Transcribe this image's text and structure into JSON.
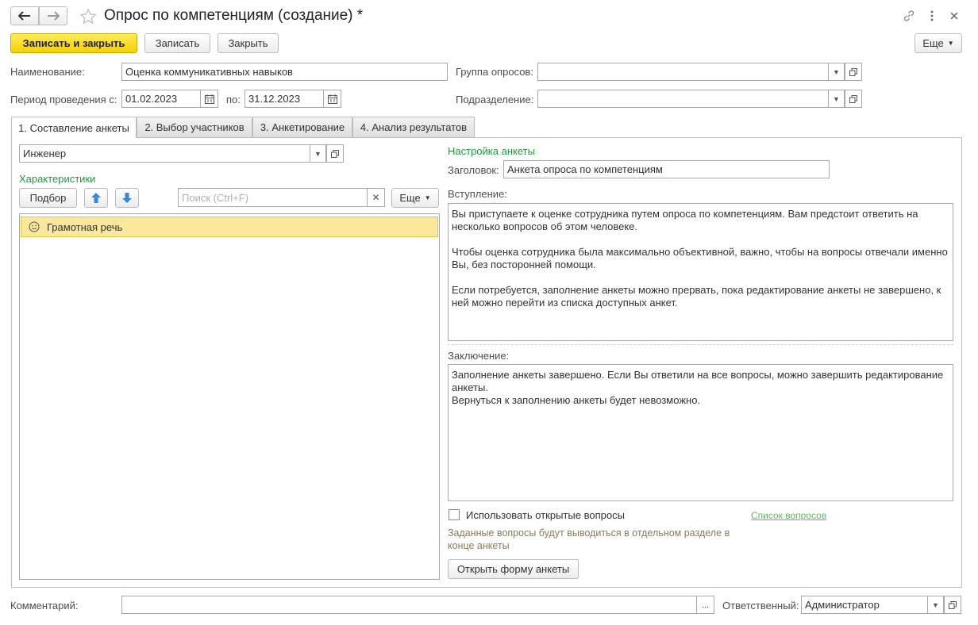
{
  "window": {
    "title": "Опрос по компетенциям (создание) *"
  },
  "toolbar": {
    "save_close_label": "Записать и закрыть",
    "save_label": "Записать",
    "close_label": "Закрыть",
    "more_label": "Еще"
  },
  "header": {
    "name_label": "Наименование:",
    "name_value": "Оценка коммуникативных навыков",
    "group_label": "Группа опросов:",
    "group_value": "",
    "period_label": "Период проведения с:",
    "period_from": "01.02.2023",
    "period_to_label": "по:",
    "period_to": "31.12.2023",
    "department_label": "Подразделение:",
    "department_value": ""
  },
  "tabs": [
    {
      "label": "1. Составление анкеты",
      "active": true
    },
    {
      "label": "2. Выбор участников",
      "active": false
    },
    {
      "label": "3. Анкетирование",
      "active": false
    },
    {
      "label": "4. Анализ результатов",
      "active": false
    }
  ],
  "left_panel": {
    "position_value": "Инженер",
    "characteristics_title": "Характеристики",
    "pick_label": "Подбор",
    "search_placeholder": "Поиск (Ctrl+F)",
    "more_label": "Еще",
    "list_items": [
      {
        "label": "Грамотная речь",
        "selected": true
      }
    ]
  },
  "right_panel": {
    "section_title": "Настройка анкеты",
    "heading_label": "Заголовок:",
    "heading_value": "Анкета опроса по компетенциям",
    "intro_label": "Вступление:",
    "intro_text": "Вы приступаете к оценке сотрудника путем опроса по компетенциям. Вам предстоит ответить на несколько вопросов об этом человеке.\n\nЧтобы оценка сотрудника была максимально объективной, важно, чтобы на вопросы отвечали именно Вы, без посторонней помощи.\n\nЕсли потребуется, заполнение анкеты можно прервать, пока редактирование анкеты не завершено, к ней можно перейти из списка доступных анкет.",
    "conclusion_label": "Заключение:",
    "conclusion_text": "Заполнение анкеты завершено. Если Вы ответили на все вопросы, можно завершить редактирование анкеты.\nВернуться к заполнению анкеты будет невозможно.",
    "open_questions_label": "Использовать открытые вопросы",
    "open_questions_checked": false,
    "questions_link": "Список вопросов",
    "hint_text": "Заданные вопросы будут выводиться в отдельном разделе в конце анкеты",
    "open_form_label": "Открыть форму анкеты"
  },
  "footer": {
    "comment_label": "Комментарий:",
    "comment_value": "",
    "responsible_label": "Ответственный:",
    "responsible_value": "Администратор"
  },
  "colors": {
    "accent_yellow": "#f5d000",
    "section_green": "#1f9a3a",
    "hint_brown": "#8a7c55",
    "selected_row": "#fbe89a"
  }
}
